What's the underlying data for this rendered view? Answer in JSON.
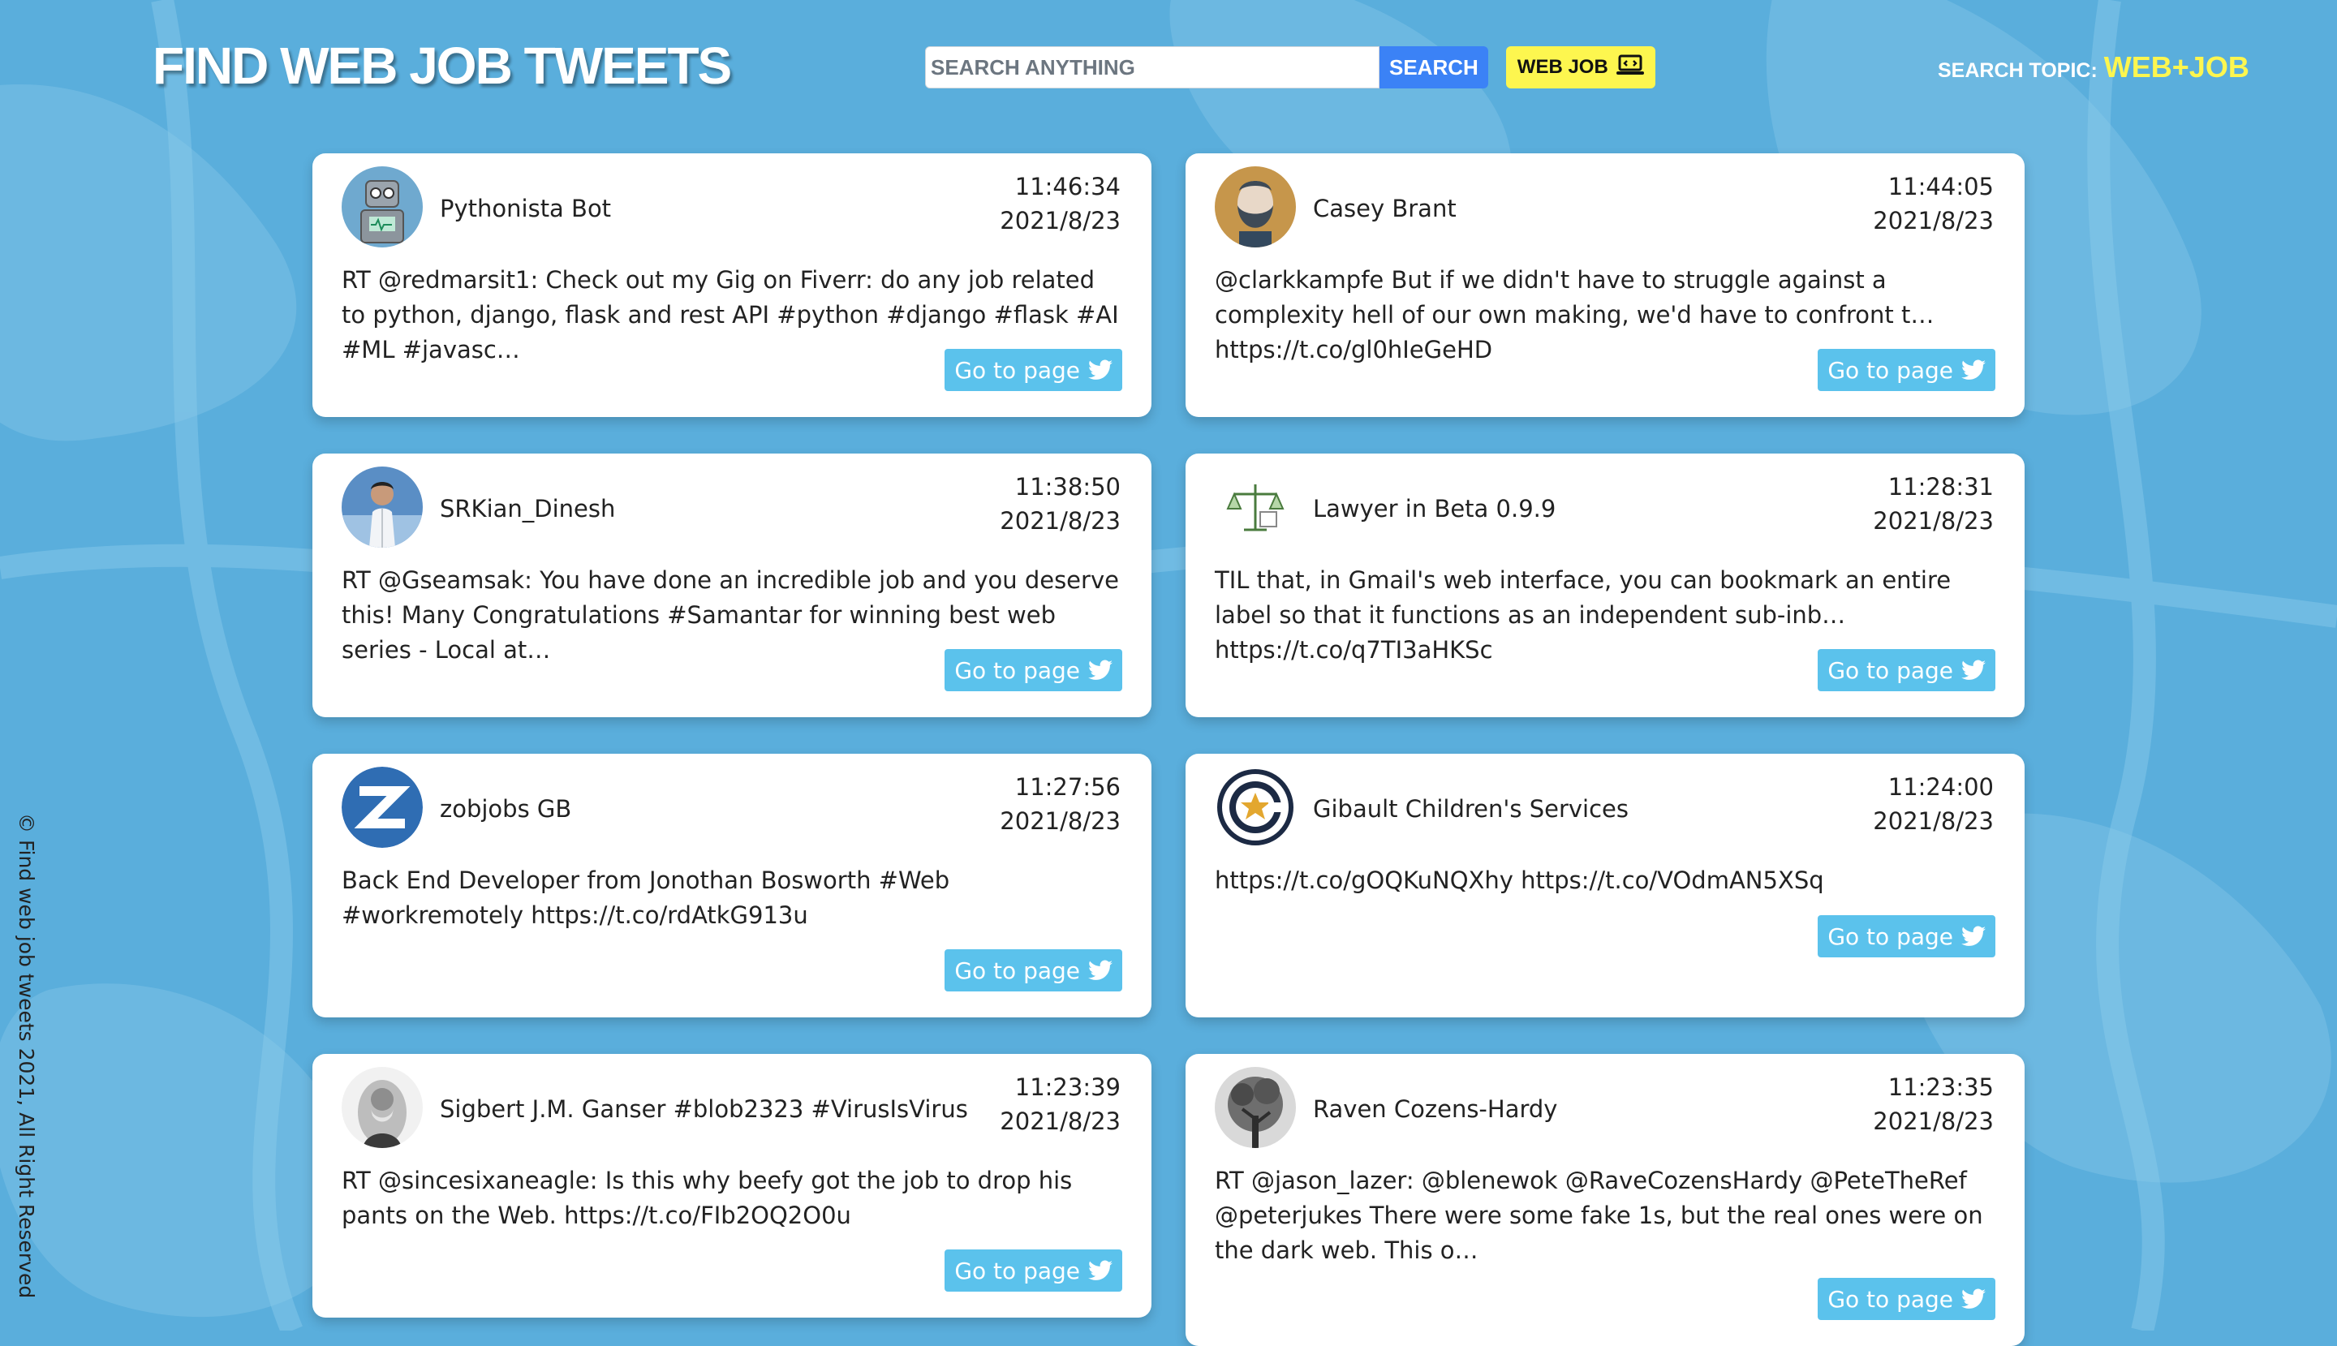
{
  "brand": {
    "title": "Find web job tweets"
  },
  "search": {
    "placeholder": "SEARCH ANYTHING",
    "value": "",
    "button_label": "SEARCH"
  },
  "web_job_button": {
    "label": "WEB JOB",
    "icon": "laptop-code-icon"
  },
  "topic": {
    "label": "SEARCH TOPIC:",
    "value": "WEB+JOB"
  },
  "colors": {
    "background": "#5aaedc",
    "search_button": "#3b82f6",
    "web_job_button": "#fdf64f",
    "topic_value": "#fdf64f",
    "go_button": "#5bc2ec"
  },
  "tweets": [
    {
      "user": "Pythonista Bot",
      "time": "11:46:34",
      "date": "2021/8/23",
      "text": "RT @redmarsit1: Check out my Gig on Fiverr: do any job related to python, django, flask and rest API #python #django #flask #AI #ML #javasc…",
      "button": "Go to page",
      "avatar_icon": "robot-avatar"
    },
    {
      "user": "Casey Brant",
      "time": "11:44:05",
      "date": "2021/8/23",
      "text": "@clarkkampfe But if we didn't have to struggle against a complexity hell of our own making, we'd have to confront t… https://t.co/gl0hIeGeHD",
      "button": "Go to page",
      "avatar_icon": "bearded-man-avatar"
    },
    {
      "user": "SRKian_Dinesh",
      "time": "11:38:50",
      "date": "2021/8/23",
      "text": "RT @Gseamsak: You have done an incredible job and you deserve this! Many Congratulations #Samantar for winning best web series - Local at…",
      "button": "Go to page",
      "avatar_icon": "person-photo-avatar"
    },
    {
      "user": "Lawyer in Beta 0.9.9",
      "time": "11:28:31",
      "date": "2021/8/23",
      "text": "TIL that, in Gmail's web interface, you can bookmark an entire label so that it functions as an independent sub-inb… https://t.co/q7TI3aHKSc",
      "button": "Go to page",
      "avatar_icon": "scales-sketch-avatar"
    },
    {
      "user": "zobjobs GB",
      "time": "11:27:56",
      "date": "2021/8/23",
      "text": "Back End Developer from Jonothan Bosworth #Web #workremotely https://t.co/rdAtkG913u",
      "button": "Go to page",
      "avatar_icon": "z-logo-avatar"
    },
    {
      "user": "Gibault Children's Services",
      "time": "11:24:00",
      "date": "2021/8/23",
      "text": "https://t.co/gOQKuNQXhy https://t.co/VOdmAN5XSq",
      "button": "Go to page",
      "avatar_icon": "star-seal-avatar"
    },
    {
      "user": "Sigbert J.M. Ganser #blob2323 #VirusIsVirus",
      "time": "11:23:39",
      "date": "2021/8/23",
      "text": "RT @sincesixaneagle: Is this why beefy got the job to drop his pants on the Web. https://t.co/FIb2OQ2O0u",
      "button": "Go to page",
      "avatar_icon": "vintage-portrait-avatar"
    },
    {
      "user": "Raven Cozens-Hardy",
      "time": "11:23:35",
      "date": "2021/8/23",
      "text": "RT @jason_lazer: @blenewok @RaveCozensHardy @PeteTheRef @peterjukes There were some fake 1s, but the real ones were on the dark web. This o…",
      "button": "Go to page",
      "avatar_icon": "tree-photo-avatar"
    }
  ],
  "footer": {
    "text": "© Find web job tweets 2021, All Right Reserved"
  }
}
